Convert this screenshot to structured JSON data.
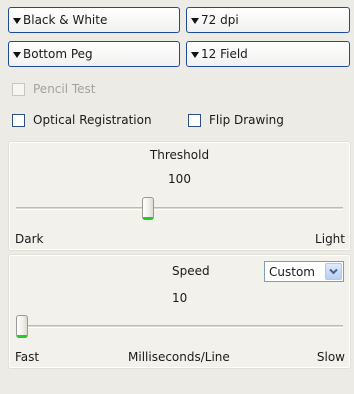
{
  "dropdowns": {
    "color_mode": "Black & White",
    "resolution": "72 dpi",
    "peg": "Bottom Peg",
    "field": "12 Field"
  },
  "checkboxes": {
    "pencil_test": "Pencil Test",
    "optical_registration": "Optical Registration",
    "flip_drawing": "Flip Drawing"
  },
  "threshold": {
    "title": "Threshold",
    "value": "100",
    "min_label": "Dark",
    "max_label": "Light",
    "level": 0.4
  },
  "speed": {
    "title": "Speed",
    "value": "10",
    "mode": "Custom",
    "min_label": "Fast",
    "unit_label": "Milliseconds/Line",
    "max_label": "Slow",
    "level": 0.0
  },
  "icons": {
    "dropdown": "caret-down-icon",
    "combo": "chevron-down-icon"
  }
}
